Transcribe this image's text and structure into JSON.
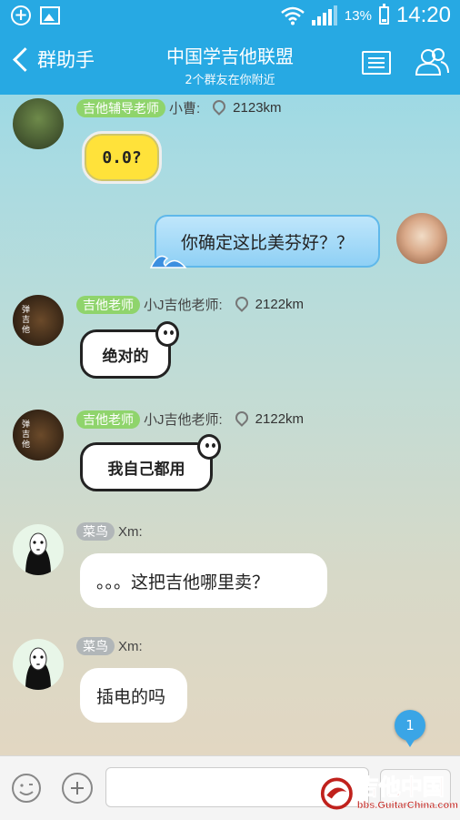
{
  "status_bar": {
    "battery_percent": "13%",
    "time": "14:20",
    "icons": [
      "add-icon",
      "image-icon",
      "wifi-icon",
      "signal-icon",
      "battery-icon"
    ]
  },
  "header": {
    "back_label": "群助手",
    "title": "中国学吉他联盟",
    "subtitle": "2个群友在你附近"
  },
  "messages": [
    {
      "sender": "小曹:",
      "badge": "吉他辅导老师",
      "distance": "2123km",
      "sticker_text": "0.0?"
    },
    {
      "self_text": "你确定这比美芬好？？"
    },
    {
      "sender": "小J吉他老师:",
      "badge": "吉他老师",
      "distance": "2122km",
      "sticker_text": "绝对的",
      "avatar_text": "弹\n吉\n他"
    },
    {
      "sender": "小J吉他老师:",
      "badge": "吉他老师",
      "distance": "2122km",
      "sticker_text": "我自己都用",
      "avatar_text": "弹\n吉\n他"
    },
    {
      "sender": "Xm:",
      "badge": "菜鸟",
      "text": "。。。这把吉他哪里卖？"
    },
    {
      "sender": "Xm:",
      "badge": "菜鸟",
      "text": "插电的吗"
    }
  ],
  "unread_count": "1",
  "input": {
    "value": "",
    "placeholder": ""
  },
  "watermark": {
    "main": "吉他中国",
    "url": "bbs.GuitarChina.com"
  },
  "colors": {
    "primary": "#27a9e3",
    "badge_green": "#8fd46c",
    "badge_gray": "#b1b6b8"
  }
}
